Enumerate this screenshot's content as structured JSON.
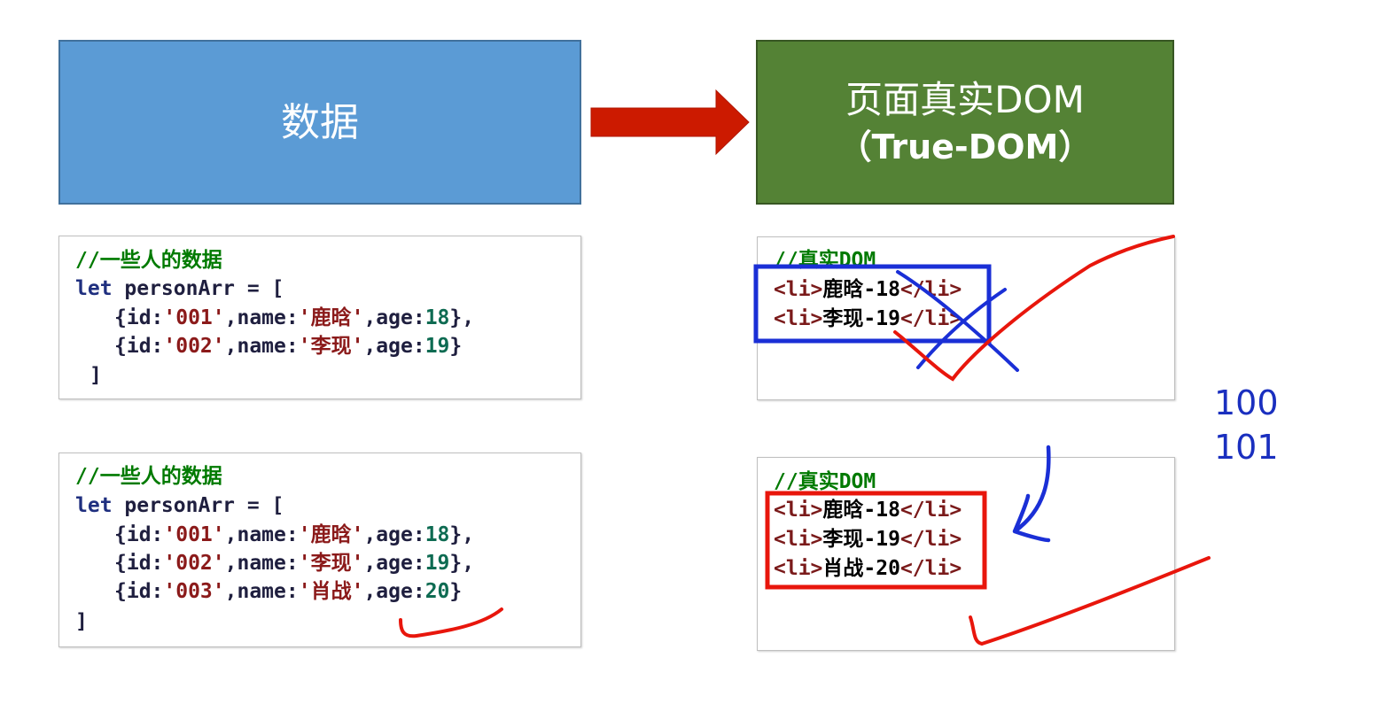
{
  "data_box": {
    "title": "数据"
  },
  "dom_box": {
    "title_line1": "页面真实DOM",
    "title_line2": "（True-DOM）"
  },
  "code_panel_1": {
    "comment": "//一些人的数据",
    "decl_kw": "let",
    "decl_rest": " personArr = [",
    "rows": [
      {
        "pre": "{id:",
        "id": "'001'",
        "mid": ",name:",
        "name": "'鹿晗'",
        "age_key": ",age:",
        "age": "18",
        "end": "},"
      },
      {
        "pre": "{id:",
        "id": "'002'",
        "mid": ",name:",
        "name": "'李现'",
        "age_key": ",age:",
        "age": "19",
        "end": "}"
      }
    ],
    "close": "]"
  },
  "code_panel_2": {
    "comment": "//一些人的数据",
    "decl_kw": "let",
    "decl_rest": " personArr = [",
    "rows": [
      {
        "pre": "{id:",
        "id": "'001'",
        "mid": ",name:",
        "name": "'鹿晗'",
        "age_key": ",age:",
        "age": "18",
        "end": "},"
      },
      {
        "pre": "{id:",
        "id": "'002'",
        "mid": ",name:",
        "name": "'李现'",
        "age_key": ",age:",
        "age": "19",
        "end": "},"
      },
      {
        "pre": "{id:",
        "id": "'003'",
        "mid": ",name:",
        "name": "'肖战'",
        "age_key": ",age:",
        "age": "20",
        "end": "}"
      }
    ],
    "close": "]"
  },
  "dom_panel_1": {
    "comment": "//真实DOM",
    "items": [
      {
        "open": "<li>",
        "text": "鹿晗-18",
        "close": "</li>"
      },
      {
        "open": "<li>",
        "text": "李现-19",
        "close": "</li>"
      }
    ]
  },
  "dom_panel_2": {
    "comment": "//真实DOM",
    "items": [
      {
        "open": "<li>",
        "text": "鹿晗-18",
        "close": "</li>"
      },
      {
        "open": "<li>",
        "text": "李现-19",
        "close": "</li>"
      },
      {
        "open": "<li>",
        "text": "肖战-20",
        "close": "</li>"
      }
    ]
  },
  "annotations": {
    "num1": "100",
    "num2": "101"
  },
  "colors": {
    "data_box": "#5b9bd5",
    "dom_box": "#548235",
    "arrow": "#cc1a00",
    "ink_red": "#e8160c",
    "ink_blue": "#1a2fd6"
  }
}
